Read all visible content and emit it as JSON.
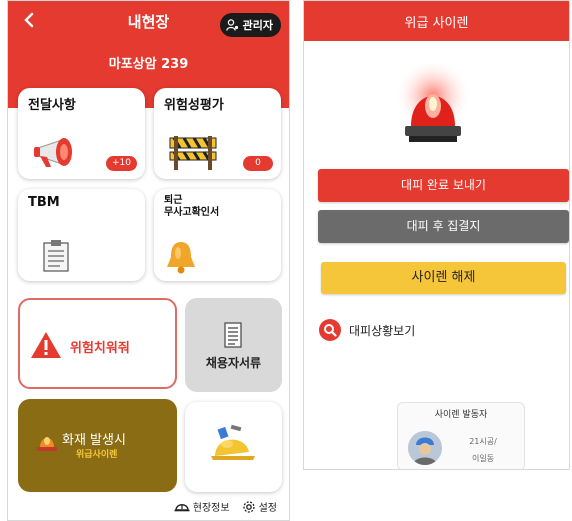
{
  "left": {
    "title": "내현장",
    "back_icon": "chevron-left-icon",
    "admin_label": "관리자",
    "site_name": "마포상암 239",
    "cards": {
      "notice": {
        "title": "전달사항",
        "badge": "+10"
      },
      "risk": {
        "title": "위험성평가",
        "badge": "0"
      },
      "tbm": {
        "title": "TBM"
      },
      "checkout": {
        "title_line1": "퇴근",
        "title_line2": "무사고확인서"
      },
      "hazard": {
        "label": "위험치워줘"
      },
      "docs": {
        "label": "채용자서류"
      },
      "fire": {
        "label": "화재 발생시",
        "sublabel": "위급사이렌"
      }
    },
    "bottom": {
      "site_info": "현장정보",
      "settings": "설정"
    }
  },
  "right": {
    "title": "위급 사이렌",
    "btn_complete": "대피 완료 보내기",
    "btn_assembly": "대피 후 집결지",
    "btn_release": "사이렌 해제",
    "view_status": "대피상황보기",
    "activator": {
      "title": "사이렌 발동자",
      "company": "21시공/",
      "name": "이일동"
    }
  },
  "colors": {
    "brand_red": "#e53a2f",
    "gray_button": "#6b6b6b",
    "yellow_button": "#f6c63a",
    "fire_card": "#8a6c14"
  }
}
